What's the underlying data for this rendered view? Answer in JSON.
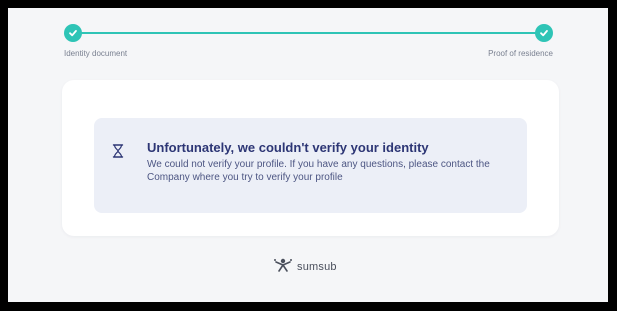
{
  "stepper": {
    "steps": [
      {
        "label": "Identity document",
        "icon": "check-icon",
        "completed": true
      },
      {
        "label": "Proof of residence",
        "icon": "check-icon",
        "completed": true
      }
    ],
    "accent_color": "#2ec4b6"
  },
  "notice": {
    "icon": "hourglass-icon",
    "title": "Unfortunately, we couldn't verify your identity",
    "message": "We could not verify your profile. If you have any questions, please contact the Company where you try to verify your profile",
    "title_color": "#2d3675",
    "background_color": "#eceff7"
  },
  "brand": {
    "name": "sumsub",
    "icon": "sumsub-logo-icon"
  }
}
